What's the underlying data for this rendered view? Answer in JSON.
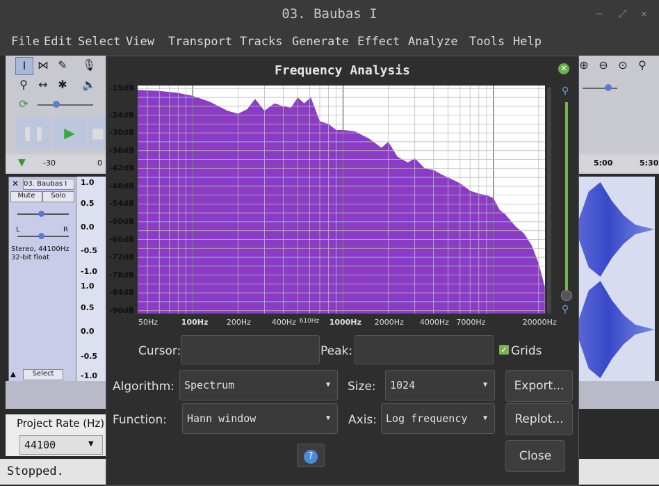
{
  "window": {
    "title": "03. Baubas I"
  },
  "menu": [
    "File",
    "Edit",
    "Select",
    "View",
    "Transport",
    "Tracks",
    "Generate",
    "Effect",
    "Analyze",
    "Tools",
    "Help"
  ],
  "timeline": {
    "t1": "-30",
    "t2": "0",
    "t3": "5:00",
    "t4": "5:30"
  },
  "track": {
    "name": "03. Baubas I",
    "mute": "Mute",
    "solo": "Solo",
    "pan_l": "L",
    "pan_r": "R",
    "info1": "Stereo, 44100Hz",
    "info2": "32-bit float",
    "select": "Select",
    "scale": [
      "1.0",
      "0.5",
      "0.0",
      "-0.5",
      "-1.0",
      "1.0",
      "0.5",
      "0.0",
      "-0.5",
      "-1.0"
    ]
  },
  "project_rate": {
    "label": "Project Rate (Hz)",
    "value": "44100"
  },
  "status": "Stopped.",
  "dialog": {
    "title": "Frequency  Analysis",
    "cursor_label": "Cursor:",
    "peak_label": "Peak:",
    "grids_label": "Grids",
    "grids_checked": true,
    "algorithm_label": "Algorithm:",
    "algorithm_value": "Spectrum",
    "size_label": "Size:",
    "size_value": "1024",
    "function_label": "Function:",
    "function_value": "Hann  window",
    "axis_label": "Axis:",
    "axis_value": "Log  frequency",
    "export_label": "Export...",
    "replot_label": "Replot...",
    "help_label": "?",
    "close_label": "Close"
  },
  "chart_data": {
    "type": "area",
    "x_scale": "log",
    "fill_color": "#8b3cc4",
    "grid": true,
    "y_tick_labels": [
      "-15dB",
      "-24dB",
      "-30dB",
      "-36dB",
      "-42dB",
      "-48dB",
      "-54dB",
      "-60dB",
      "-66dB",
      "-72dB",
      "-78dB",
      "-84dB",
      "-90dB"
    ],
    "x_tick_labels": [
      "50Hz",
      "100Hz",
      "200Hz",
      "400Hz",
      "610Hz",
      "1000Hz",
      "2000Hz",
      "4000Hz",
      "7000Hz",
      "20000Hz"
    ],
    "ylim": [
      -91,
      -14
    ],
    "xlim": [
      43,
      22050
    ],
    "x": [
      43,
      60,
      80,
      100,
      130,
      170,
      200,
      230,
      260,
      300,
      350,
      400,
      450,
      500,
      550,
      610,
      700,
      800,
      900,
      1000,
      1200,
      1500,
      1800,
      2000,
      2300,
      2700,
      3000,
      3500,
      4000,
      4500,
      5000,
      6000,
      7000,
      8000,
      9000,
      10000,
      11000,
      12000,
      14000,
      16000,
      18000,
      20000,
      22000
    ],
    "y": [
      -15.5,
      -15.8,
      -16.5,
      -17.5,
      -19.5,
      -22.5,
      -23.5,
      -22,
      -18.5,
      -22.5,
      -20,
      -21,
      -21.5,
      -18,
      -20,
      -18,
      -26,
      -27,
      -29,
      -29,
      -29.5,
      -32,
      -35,
      -33,
      -38,
      -40,
      -38.5,
      -42,
      -42.5,
      -44,
      -45,
      -47,
      -49.5,
      -50.5,
      -51,
      -52,
      -56,
      -57.5,
      -61.5,
      -64,
      -68,
      -74,
      -82
    ]
  }
}
